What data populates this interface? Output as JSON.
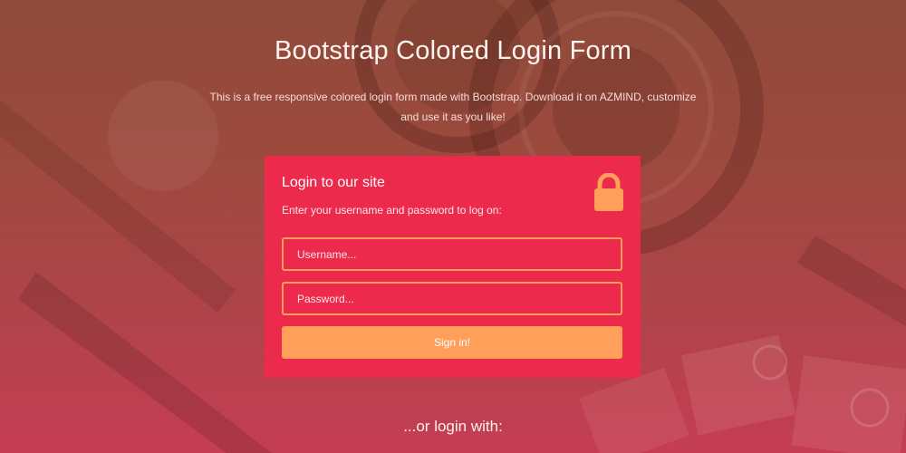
{
  "hero": {
    "title": "Bootstrap Colored Login Form",
    "description": "This is a free responsive colored login form made with Bootstrap. Download it on AZMIND, customize and use it as you like!"
  },
  "login_card": {
    "title": "Login to our site",
    "subtitle": "Enter your username and password to log on:",
    "username_placeholder": "Username...",
    "password_placeholder": "Password...",
    "signin_label": "Sign in!",
    "icon": "lock-icon"
  },
  "alt_login": {
    "text": "...or login with:"
  },
  "colors": {
    "card_bg": "#ec2a4c",
    "accent": "#ff9f5a",
    "background_top": "#8f4b3a",
    "background_bottom": "#c53d54"
  }
}
